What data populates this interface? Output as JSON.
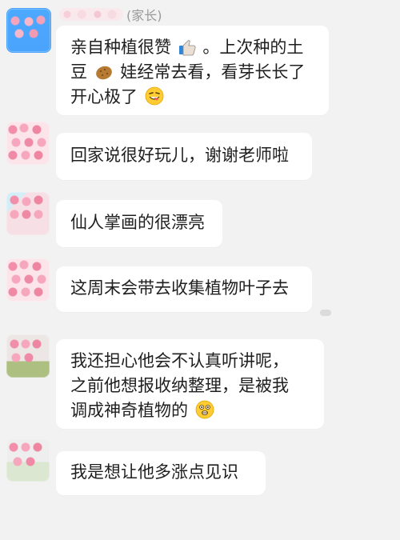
{
  "header": {
    "sender_role": "(家长)"
  },
  "messages": [
    {
      "lines": [
        "亲自种植很赞",
        "。上次种的土",
        "豆",
        "娃经常去看，看芽长长了",
        "开心极了"
      ],
      "icons": [
        "thumb-icon",
        "potato-icon",
        "grinning-tongue-icon"
      ]
    },
    {
      "lines": [
        "回家说很好玩儿，谢谢老师啦"
      ]
    },
    {
      "lines": [
        "仙人掌画的很漂亮"
      ]
    },
    {
      "lines": [
        "这周末会带去收集植物叶子去"
      ]
    },
    {
      "lines": [
        "我还担心他会不认真听讲呢，",
        "之前他想报收纳整理，是被我",
        "调成神奇植物的"
      ],
      "icons": [
        "astonished-face-icon"
      ]
    },
    {
      "lines": [
        "我是想让他多涨点见识"
      ]
    }
  ],
  "colors": {
    "background": "#f2f2f2",
    "bubble": "#ffffff",
    "text": "#1f1f1f",
    "meta_text": "#9a9a9a",
    "avatar_blue": "#4aa4fb",
    "avatar_pink": "#f6a7bd"
  }
}
